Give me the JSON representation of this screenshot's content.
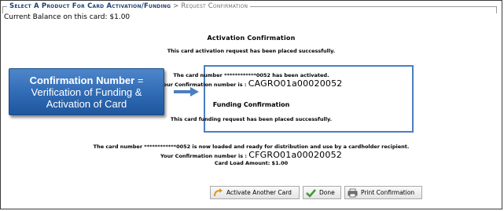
{
  "header": {
    "crumb": "Select A Product For Card Activation/Funding",
    "separator": ">",
    "current": "Request Confirmation"
  },
  "balance": "Current Balance on this card: $1.00",
  "activation": {
    "title": "Activation Confirmation",
    "message": "This card activation request has been placed successfully.",
    "card_line": "The card number ************0052 has been activated.",
    "conf_label": "Your Confirmation number is : ",
    "conf_number": "CAGRO01a00020052"
  },
  "funding": {
    "title": "Funding Confirmation",
    "message": "This card funding request has been placed successfully.",
    "card_line": "The card number ************0052 is now loaded and ready for distribution and use by a cardholder recipient.",
    "conf_label": "Your Confirmation number is : ",
    "conf_number": "CFGRO01a00020052",
    "load_amount": "Card Load Amount: $1.00"
  },
  "callout": {
    "bold": "Confirmation Number",
    "eq": " =",
    "line2": "Verification of Funding &",
    "line3": "Activation of Card"
  },
  "buttons": {
    "activate": "Activate Another Card",
    "done": "Done",
    "print": "Print Confirmation"
  },
  "icons": {
    "activate": "curved-arrow-icon",
    "done": "checkmark-icon",
    "print": "printer-icon"
  },
  "colors": {
    "highlight_border": "#4a7fc1",
    "callout_bg": "#2f6ab4",
    "arrow": "#4a7fc1"
  }
}
